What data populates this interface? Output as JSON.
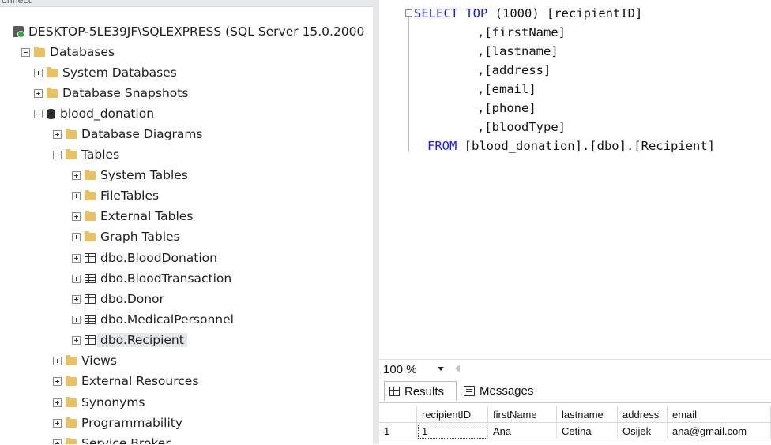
{
  "explorer": {
    "top_stub": "onnect",
    "rows": [
      {
        "label": "DESKTOP-5LE39JF\\SQLEXPRESS (SQL Server 15.0.2000"
      },
      {
        "label": "Databases"
      },
      {
        "label": "System Databases"
      },
      {
        "label": "Database Snapshots"
      },
      {
        "label": "blood_donation"
      },
      {
        "label": "Database Diagrams"
      },
      {
        "label": "Tables"
      },
      {
        "label": "System Tables"
      },
      {
        "label": "FileTables"
      },
      {
        "label": "External Tables"
      },
      {
        "label": "Graph Tables"
      },
      {
        "label": "dbo.BloodDonation"
      },
      {
        "label": "dbo.BloodTransaction"
      },
      {
        "label": "dbo.Donor"
      },
      {
        "label": "dbo.MedicalPersonnel"
      },
      {
        "label": "dbo.Recipient"
      },
      {
        "label": "Views"
      },
      {
        "label": "External Resources"
      },
      {
        "label": "Synonyms"
      },
      {
        "label": "Programmability"
      },
      {
        "label": "Service Broker"
      }
    ]
  },
  "editor": {
    "line1": {
      "kw1": "SELECT",
      "kw2": "TOP",
      "rest": " (1000) [recipientID]"
    },
    "line2": ",[firstName]",
    "line3": ",[lastname]",
    "line4": ",[address]",
    "line5": ",[email]",
    "line6": ",[phone]",
    "line7": ",[bloodType]",
    "line8": {
      "kw": "FROM",
      "rest": " [blood_donation].[dbo].[Recipient]"
    }
  },
  "zoom": {
    "value": "100 %"
  },
  "results_tabs": {
    "results": "Results",
    "messages": "Messages"
  },
  "results_grid": {
    "columns": [
      "recipientID",
      "firstName",
      "lastname",
      "address",
      "email"
    ],
    "rows": [
      {
        "rownum": "1",
        "cells": [
          "1",
          "Ana",
          "Cetina",
          "Osijek",
          "ana@gmail.com"
        ]
      }
    ]
  },
  "colors": {
    "keyword": "#1a1aff",
    "folder": "#e8c163",
    "selection": "#e5e7eb"
  }
}
